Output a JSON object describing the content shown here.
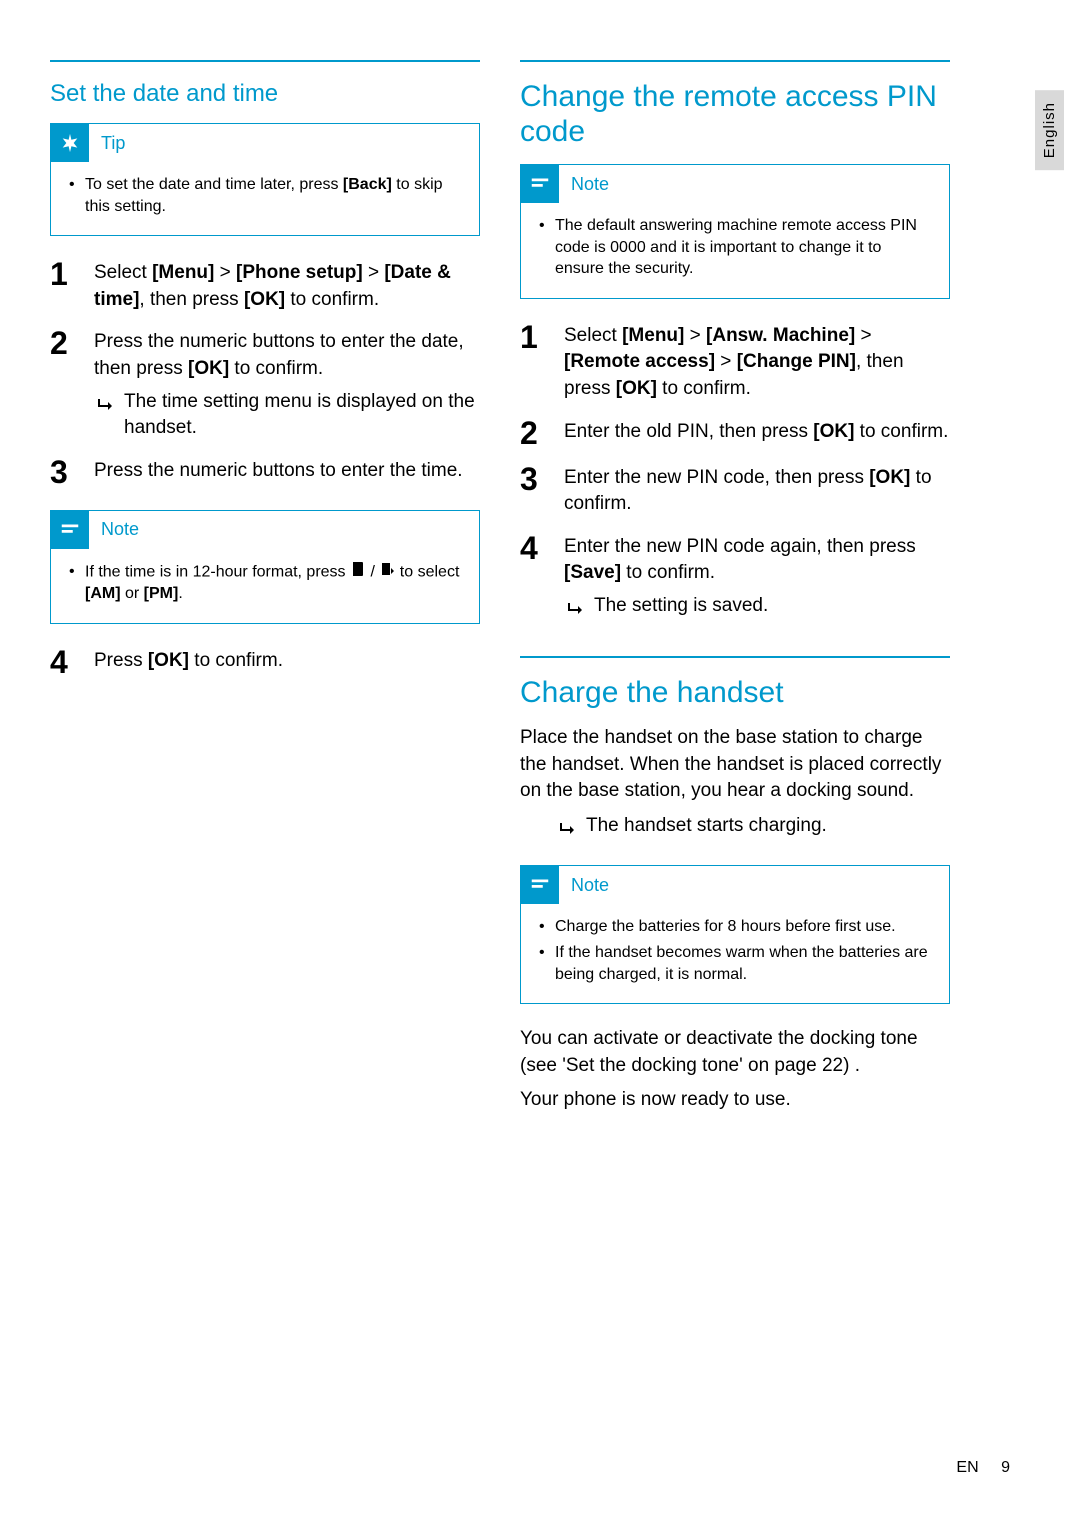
{
  "lang_tab": "English",
  "left": {
    "heading1": "Set the date and time",
    "tip_label": "Tip",
    "tip_items": [
      "To set the date and time later, press [Back] to skip this setting."
    ],
    "steps_a": [
      "Select [Menu] > [Phone setup] > [Date & time], then press [OK] to confirm.",
      "Press the numeric buttons to enter the date, then press [OK] to confirm.",
      "Press the numeric buttons to enter the time."
    ],
    "step2_sub": "The time setting menu is displayed on the handset.",
    "note_label": "Note",
    "note_items_prefix": "If the time is in 12-hour format, press ",
    "note_items_suffix": " to select [AM] or [PM].",
    "step4": "Press [OK] to confirm."
  },
  "right": {
    "heading1": "Change the remote access PIN code",
    "note1_label": "Note",
    "note1_items": [
      "The default answering machine remote access PIN code is 0000 and it is important to change it to ensure the security."
    ],
    "steps": [
      "Select [Menu] > [Answ. Machine] > [Remote access] > [Change PIN], then press [OK] to confirm.",
      "Enter the old PIN, then press [OK] to confirm.",
      "Enter the new PIN code, then press [OK] to confirm.",
      "Enter the new PIN code again, then press [Save] to confirm."
    ],
    "step4_sub": "The setting is saved.",
    "heading2": "Charge the handset",
    "para1": "Place the handset on the base station to charge the handset. When the handset is placed correctly on the base station, you hear a docking sound.",
    "para1_sub": "The handset starts charging.",
    "note2_label": "Note",
    "note2_items": [
      "Charge the batteries for 8 hours before first use.",
      "If the handset becomes warm when the batteries are being charged, it is normal."
    ],
    "para2": "You can activate or deactivate the docking tone (see 'Set the docking tone' on page 22) .",
    "para3": "Your phone is now ready to use."
  },
  "footer": {
    "lang": "EN",
    "page": "9"
  }
}
